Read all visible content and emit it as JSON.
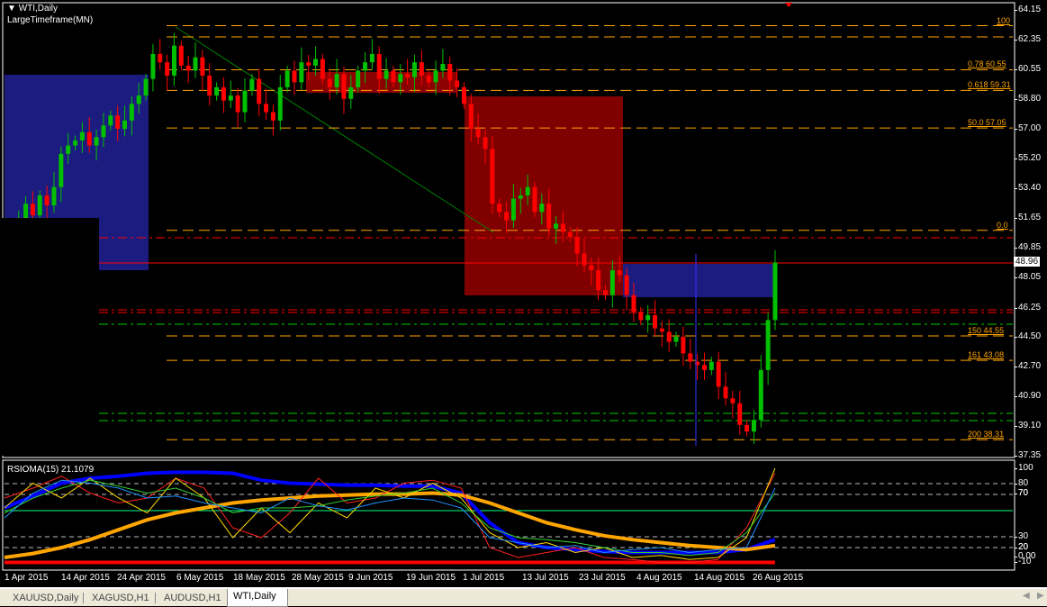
{
  "header": {
    "symbol": "WTI,Daily",
    "indicator": "LargeTimeframe(MN)"
  },
  "price_axis": [
    "64.15",
    "62.35",
    "60.55",
    "58.80",
    "57.00",
    "55.20",
    "53.40",
    "51.65",
    "49.85",
    "48.05",
    "46.25",
    "44.50",
    "42.70",
    "40.90",
    "39.10",
    "37.35"
  ],
  "current_price": "48.96",
  "fib_labels": [
    {
      "lvl": "100",
      "price": ""
    },
    {
      "lvl": "0.78",
      "price": "60.55"
    },
    {
      "lvl": "0.618",
      "price": "59.31"
    },
    {
      "lvl": "50.0",
      "price": "57.05"
    },
    {
      "lvl": "0.0",
      "price": ""
    },
    {
      "lvl": "150",
      "price": "44.55"
    },
    {
      "lvl": "161",
      "price": "43.08"
    },
    {
      "lvl": "200",
      "price": "38.31"
    }
  ],
  "indicator": {
    "title": "RSIOMA(15) 21.1079",
    "axis": [
      "100",
      "80",
      "70",
      "70",
      "30",
      "20",
      "20",
      "0.00",
      "-10"
    ]
  },
  "date_axis": [
    "1 Apr 2015",
    "14 Apr 2015",
    "24 Apr 2015",
    "6 May 2015",
    "18 May 2015",
    "28 May 2015",
    "9 Jun 2015",
    "19 Jun 2015",
    "1 Jul 2015",
    "13 Jul 2015",
    "23 Jul 2015",
    "4 Aug 2015",
    "14 Aug 2015",
    "26 Aug 2015"
  ],
  "tabs": [
    {
      "label": "XAUUSD,Daily"
    },
    {
      "label": "XAGUSD,H1"
    },
    {
      "label": "AUDUSD,H1"
    },
    {
      "label": "WTI,Daily",
      "active": true
    }
  ],
  "colors": {
    "bull": "#00c000",
    "bear": "#ff0000",
    "fib": "#ffa500"
  },
  "chart_data": {
    "type": "candlestick",
    "price_range": [
      37.35,
      64.15
    ],
    "closes": [
      49.5,
      50.3,
      51.2,
      52.5,
      51.8,
      53.0,
      52.4,
      53.5,
      55.5,
      56.0,
      56.3,
      56.8,
      56.0,
      56.5,
      57.2,
      57.8,
      57.0,
      57.5,
      58.5,
      59.0,
      60.0,
      61.5,
      61.0,
      60.2,
      62.0,
      60.8,
      60.5,
      61.3,
      60.2,
      59.0,
      59.5,
      58.7,
      59.0,
      58.0,
      59.3,
      60.0,
      58.5,
      58.0,
      57.5,
      59.5,
      60.5,
      59.8,
      61.0,
      60.8,
      61.2,
      60.0,
      59.5,
      60.3,
      58.8,
      59.5,
      60.5,
      61.0,
      61.5,
      60.0,
      60.5,
      59.8,
      60.3,
      60.1,
      61.0,
      60.2,
      59.8,
      60.5,
      60.9,
      59.9,
      59.5,
      58.5,
      57.0,
      56.5,
      55.8,
      52.5,
      52.0,
      51.5,
      52.8,
      53.0,
      53.5,
      52.0,
      52.5,
      51.0,
      51.3,
      50.8,
      50.5,
      49.5,
      48.8,
      48.5,
      47.3,
      47.0,
      48.5,
      48.2,
      47.0,
      46.0,
      45.5,
      45.8,
      45.0,
      44.8,
      44.2,
      44.5,
      43.5,
      43.0,
      42.8,
      42.5,
      43.0,
      41.5,
      40.8,
      40.5,
      39.2,
      38.8,
      39.5,
      42.5,
      45.5,
      48.96
    ],
    "fib_levels": [
      {
        "ratio": "100",
        "price": 63.2
      },
      {
        "ratio": "0.78",
        "price": 60.55
      },
      {
        "ratio": "0.618",
        "price": 59.31
      },
      {
        "ratio": "50.0",
        "price": 57.05
      },
      {
        "ratio": "0.0",
        "price": 50.9
      },
      {
        "ratio": "150",
        "price": 44.55
      },
      {
        "ratio": "161",
        "price": 43.08
      },
      {
        "ratio": "200",
        "price": 38.31
      }
    ],
    "indicator_series": [
      {
        "name": "slow-blue",
        "color": "#0000ff",
        "width": 4,
        "values": [
          60,
          72,
          85,
          90,
          92,
          95,
          96,
          96,
          95,
          88,
          85,
          84,
          83,
          83,
          82,
          82,
          75,
          45,
          25,
          20,
          18,
          16,
          15,
          15,
          15,
          15,
          18,
          28
        ]
      },
      {
        "name": "orange-ma",
        "color": "#ffa500",
        "width": 4,
        "values": [
          10,
          14,
          20,
          28,
          38,
          48,
          55,
          60,
          65,
          68,
          70,
          72,
          73,
          74,
          74,
          75,
          73,
          65,
          55,
          45,
          38,
          32,
          28,
          25,
          22,
          20,
          18,
          22
        ]
      },
      {
        "name": "red-base",
        "color": "#ff0000",
        "width": 4,
        "values": [
          5,
          5,
          5,
          5,
          5,
          5,
          5,
          5,
          5,
          5,
          5,
          5,
          5,
          5,
          5,
          5,
          5,
          5,
          5,
          5,
          5,
          5,
          5,
          5,
          5,
          5,
          5,
          5
        ]
      },
      {
        "name": "red",
        "color": "#ff2020",
        "width": 1,
        "values": [
          70,
          80,
          92,
          75,
          65,
          70,
          90,
          80,
          40,
          30,
          55,
          90,
          65,
          70,
          85,
          88,
          80,
          20,
          10,
          15,
          20,
          10,
          8,
          5,
          5,
          8,
          40,
          95
        ]
      },
      {
        "name": "yellow",
        "color": "#ffd700",
        "width": 1,
        "values": [
          60,
          85,
          70,
          90,
          70,
          55,
          90,
          70,
          30,
          60,
          35,
          65,
          50,
          80,
          70,
          85,
          70,
          35,
          20,
          25,
          15,
          20,
          10,
          12,
          8,
          10,
          30,
          100
        ]
      },
      {
        "name": "green",
        "color": "#32cd32",
        "width": 1,
        "values": [
          55,
          70,
          80,
          88,
          82,
          75,
          80,
          70,
          55,
          60,
          60,
          62,
          68,
          72,
          75,
          80,
          65,
          40,
          30,
          28,
          25,
          20,
          15,
          15,
          12,
          15,
          35,
          75
        ]
      },
      {
        "name": "lightblue",
        "color": "#1e90ff",
        "width": 1,
        "values": [
          50,
          75,
          88,
          85,
          80,
          70,
          72,
          65,
          60,
          55,
          70,
          62,
          58,
          65,
          70,
          68,
          60,
          30,
          25,
          20,
          22,
          15,
          18,
          20,
          15,
          18,
          20,
          80
        ]
      }
    ]
  }
}
